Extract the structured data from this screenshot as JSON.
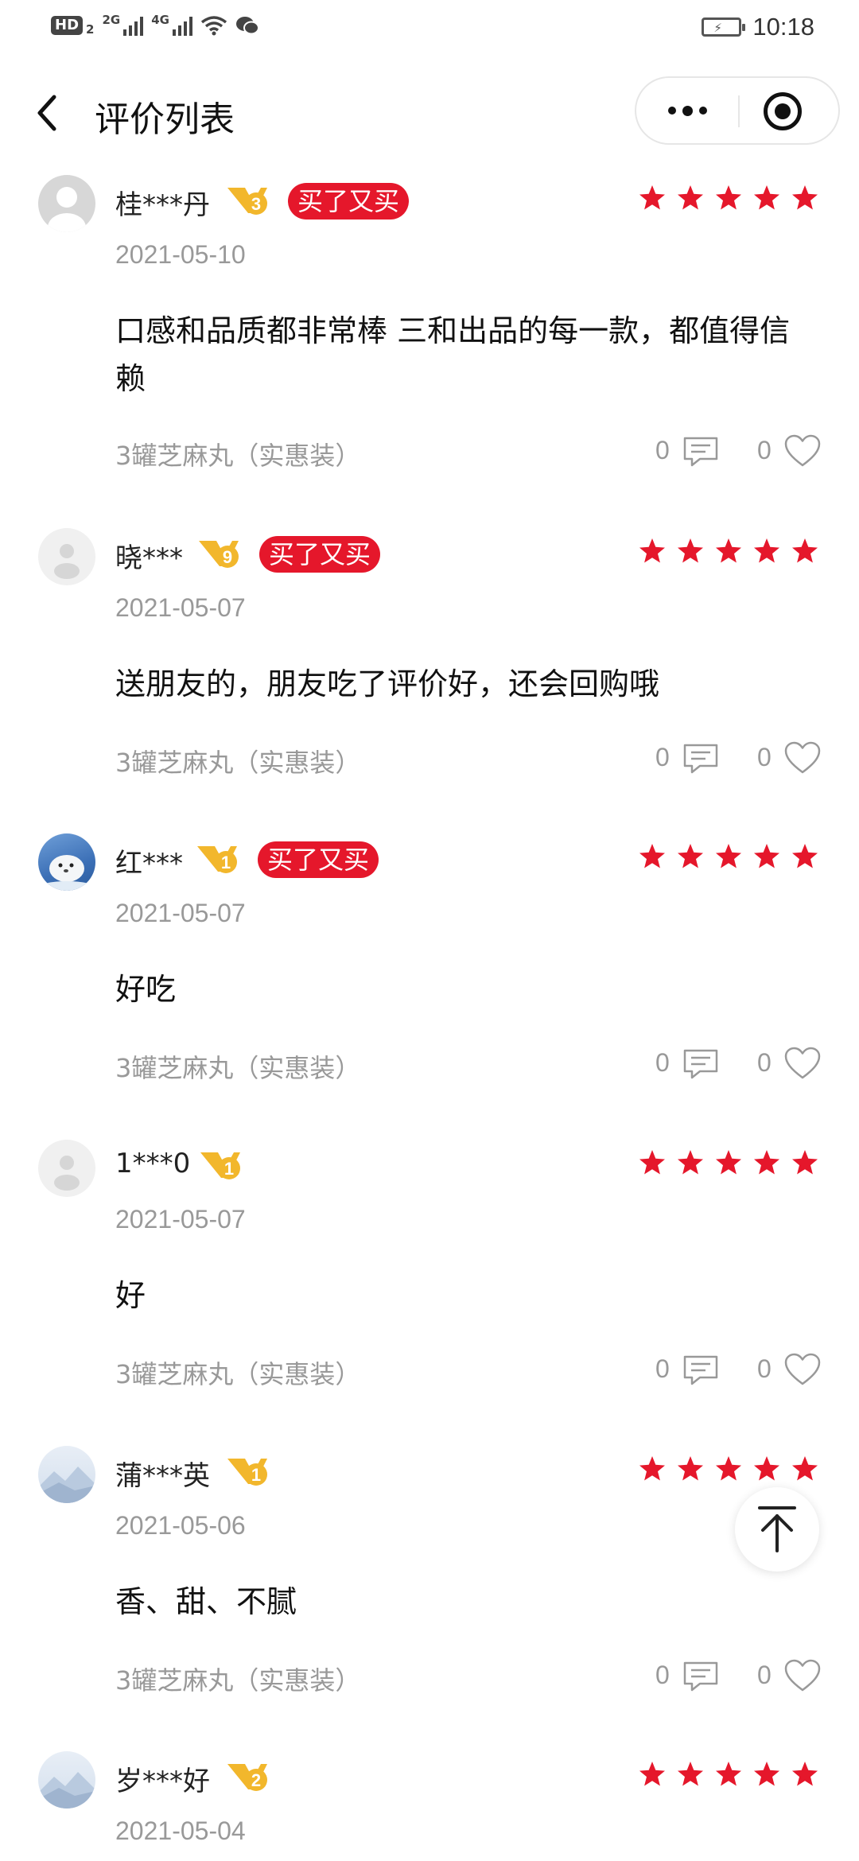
{
  "status_bar": {
    "hd": "HD",
    "hd_sub": "2",
    "net1": "2G",
    "net2": "4G",
    "time": "10:18"
  },
  "header": {
    "title": "评价列表"
  },
  "colors": {
    "accent_red": "#e5172b",
    "star_red": "#e5172b",
    "muted_text": "#999999",
    "vip_gold": "#f2b72c"
  },
  "reviews": [
    {
      "username": "桂***丹",
      "vip_level": "3",
      "rebuy_label": "买了又买",
      "rating": 5,
      "date": "2021-05-10",
      "text": "口感和品质都非常棒 三和出品的每一款，都值得信赖",
      "variant": "3罐芝麻丸（实惠装）",
      "comments": "0",
      "likes": "0"
    },
    {
      "username": "晓***",
      "vip_level": "9",
      "rebuy_label": "买了又买",
      "rating": 5,
      "date": "2021-05-07",
      "text": "送朋友的，朋友吃了评价好，还会回购哦",
      "variant": "3罐芝麻丸（实惠装）",
      "comments": "0",
      "likes": "0"
    },
    {
      "username": "红***",
      "vip_level": "1",
      "rebuy_label": "买了又买",
      "rating": 5,
      "date": "2021-05-07",
      "text": "好吃",
      "variant": "3罐芝麻丸（实惠装）",
      "comments": "0",
      "likes": "0"
    },
    {
      "username": "1***0",
      "vip_level": "1",
      "rating": 5,
      "date": "2021-05-07",
      "text": "好",
      "variant": "3罐芝麻丸（实惠装）",
      "comments": "0",
      "likes": "0"
    },
    {
      "username": "蒲***英",
      "vip_level": "1",
      "rating": 5,
      "date": "2021-05-06",
      "text": "香、甜、不腻",
      "variant": "3罐芝麻丸（实惠装）",
      "comments": "0",
      "likes": "0"
    },
    {
      "username": "岁***好",
      "vip_level": "2",
      "rating": 5,
      "date": "2021-05-04"
    }
  ]
}
